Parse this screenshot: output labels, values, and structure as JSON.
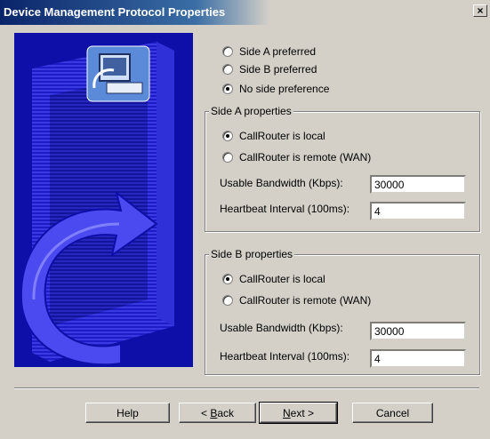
{
  "window": {
    "title": "Device Management Protocol Properties",
    "close_glyph": "×"
  },
  "side_preference": {
    "options": [
      {
        "label": "Side A preferred",
        "checked": false
      },
      {
        "label": "Side B preferred",
        "checked": false
      },
      {
        "label": "No side preference",
        "checked": true
      }
    ]
  },
  "side_a": {
    "title": "Side A properties",
    "local_label": "CallRouter is local",
    "remote_label": "CallRouter is remote (WAN)",
    "local_checked": true,
    "bandwidth_label": "Usable Bandwidth (Kbps):",
    "bandwidth_value": "30000",
    "heartbeat_label": "Heartbeat Interval (100ms):",
    "heartbeat_value": "4"
  },
  "side_b": {
    "title": "Side B properties",
    "local_label": "CallRouter is local",
    "remote_label": "CallRouter is remote (WAN)",
    "local_checked": true,
    "bandwidth_label": "Usable Bandwidth (Kbps):",
    "bandwidth_value": "30000",
    "heartbeat_label": "Heartbeat Interval (100ms):",
    "heartbeat_value": "4"
  },
  "buttons": {
    "help": "Help",
    "back_prefix": "< ",
    "back_key": "B",
    "back_rest": "ack",
    "next_key": "N",
    "next_rest": "ext >",
    "cancel": "Cancel"
  },
  "colors": {
    "wizard_art_bg": "#0e0ea8",
    "title_bar": "#0a246a"
  },
  "icons": {
    "wizard_art": "computer-wizard-icon",
    "close": "close-icon"
  }
}
